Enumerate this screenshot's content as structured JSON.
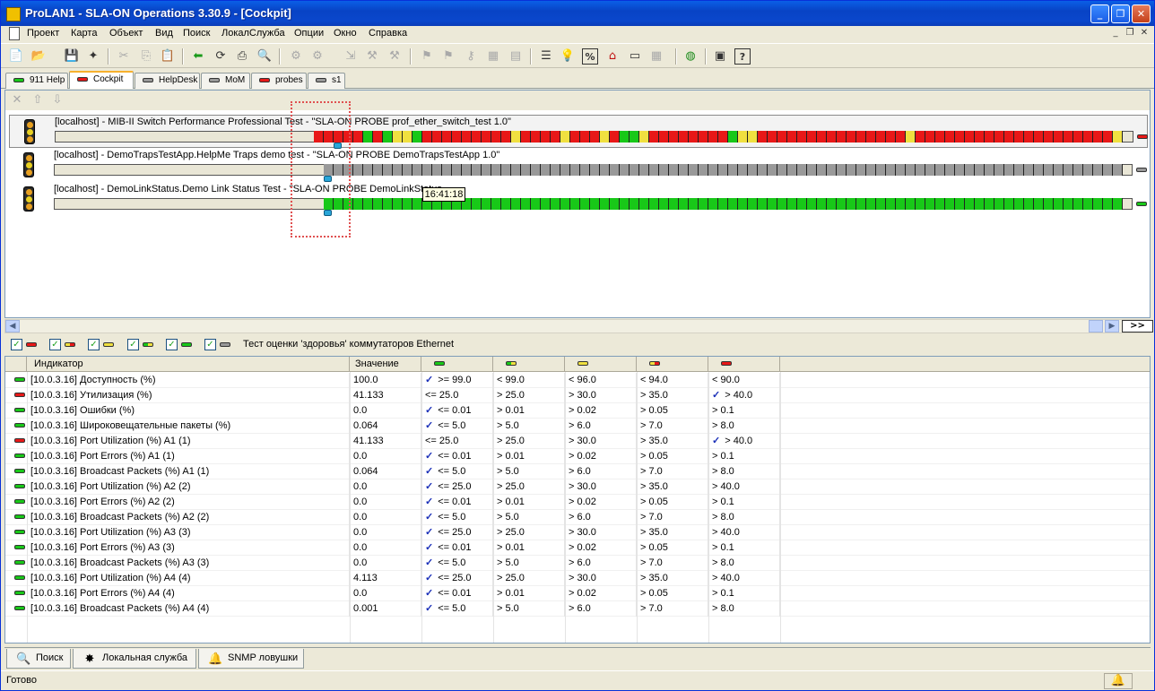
{
  "window": {
    "title": "ProLAN1 - SLA-ON Operations 3.30.9 - [Cockpit]"
  },
  "menu": [
    "Проект",
    "Карта",
    "Объект",
    "Вид",
    "Поиск",
    "ЛокалСлужба",
    "Опции",
    "Окно",
    "Справка"
  ],
  "toolbar_icons": [
    "new-icon",
    "open-icon",
    "save-icon",
    "wand-icon",
    "cut-icon",
    "copy-icon",
    "paste-icon",
    "back-icon",
    "refresh-icon",
    "browse-icon",
    "find-icon",
    "probe-icon",
    "map-icon",
    "discover-icon",
    "tool-icon",
    "tool-icon",
    "tool-icon",
    "tool-icon",
    "tool-icon",
    "tool-icon",
    "list-icon",
    "lightbulb-icon",
    "percent-icon",
    "home-icon",
    "monitor-icon",
    "table-icon",
    "globe-icon",
    "properties-icon",
    "help-icon"
  ],
  "tabs": [
    {
      "label": "911 Help",
      "color": "g"
    },
    {
      "label": "Cockpit",
      "color": "r",
      "active": true
    },
    {
      "label": "HelpDesk",
      "color": "gr"
    },
    {
      "label": "MoM",
      "color": "gr"
    },
    {
      "label": "probes",
      "color": "r"
    },
    {
      "label": "s1",
      "color": "gr"
    }
  ],
  "probes": [
    {
      "title": "[localhost] - MIB-II Switch Performance Professional Test - \"SLA-ON PROBE prof_ether_switch_test 1.0\"",
      "status": "r",
      "history": "rrrrrgrgyygrrrrrrrrryrrrryrrryrggyrrrrrrrrgyyrrrrrrrrrrrrrrryrrrrrrrrrrrrrrrrrrrryyyrrrrrrrrrrrrrryyryrrrr"
    },
    {
      "title": "[localhost] - DemoTrapsTestApp.HelpMe Traps demo test - \"SLA-ON PROBE DemoTrapsTestApp 1.0\"",
      "status": "gr"
    },
    {
      "title": "[localhost] - DemoLinkStatus.Demo Link Status Test - \"SLA-ON PROBE DemoLinkStatus",
      "status": "g"
    }
  ],
  "tooltip": "16:41:18",
  "filter_label": "Тест оценки 'здоровья' коммутаторов Ethernet",
  "grid": {
    "headers": [
      "Индикатор",
      "Значение"
    ],
    "threshold_colors": [
      "g",
      "gy",
      "y",
      "yr",
      "r"
    ],
    "rows": [
      {
        "status": "g",
        "name": "[10.0.3.16] Доступность (%)",
        "value": "100.0",
        "t": [
          ">= 99.0",
          "< 99.0",
          "< 96.0",
          "< 94.0",
          "< 90.0"
        ],
        "check": 0
      },
      {
        "status": "r",
        "name": "[10.0.3.16] Утилизация (%)",
        "value": "41.133",
        "t": [
          "<= 25.0",
          "> 25.0",
          "> 30.0",
          "> 35.0",
          "> 40.0"
        ],
        "check": 4
      },
      {
        "status": "g",
        "name": "[10.0.3.16] Ошибки (%)",
        "value": "0.0",
        "t": [
          "<= 0.01",
          "> 0.01",
          "> 0.02",
          "> 0.05",
          "> 0.1"
        ],
        "check": 0
      },
      {
        "status": "g",
        "name": "[10.0.3.16] Широковещательные пакеты (%)",
        "value": "0.064",
        "t": [
          "<= 5.0",
          "> 5.0",
          "> 6.0",
          "> 7.0",
          "> 8.0"
        ],
        "check": 0
      },
      {
        "status": "r",
        "name": "[10.0.3.16] Port Utilization (%) A1 (1)",
        "value": "41.133",
        "t": [
          "<= 25.0",
          "> 25.0",
          "> 30.0",
          "> 35.0",
          "> 40.0"
        ],
        "check": 4
      },
      {
        "status": "g",
        "name": "[10.0.3.16] Port Errors (%) A1 (1)",
        "value": "0.0",
        "t": [
          "<= 0.01",
          "> 0.01",
          "> 0.02",
          "> 0.05",
          "> 0.1"
        ],
        "check": 0
      },
      {
        "status": "g",
        "name": "[10.0.3.16] Broadcast Packets (%) A1 (1)",
        "value": "0.064",
        "t": [
          "<= 5.0",
          "> 5.0",
          "> 6.0",
          "> 7.0",
          "> 8.0"
        ],
        "check": 0
      },
      {
        "status": "g",
        "name": "[10.0.3.16] Port Utilization (%) A2 (2)",
        "value": "0.0",
        "t": [
          "<= 25.0",
          "> 25.0",
          "> 30.0",
          "> 35.0",
          "> 40.0"
        ],
        "check": 0
      },
      {
        "status": "g",
        "name": "[10.0.3.16] Port Errors (%) A2 (2)",
        "value": "0.0",
        "t": [
          "<= 0.01",
          "> 0.01",
          "> 0.02",
          "> 0.05",
          "> 0.1"
        ],
        "check": 0
      },
      {
        "status": "g",
        "name": "[10.0.3.16] Broadcast Packets (%) A2 (2)",
        "value": "0.0",
        "t": [
          "<= 5.0",
          "> 5.0",
          "> 6.0",
          "> 7.0",
          "> 8.0"
        ],
        "check": 0
      },
      {
        "status": "g",
        "name": "[10.0.3.16] Port Utilization (%) A3 (3)",
        "value": "0.0",
        "t": [
          "<= 25.0",
          "> 25.0",
          "> 30.0",
          "> 35.0",
          "> 40.0"
        ],
        "check": 0
      },
      {
        "status": "g",
        "name": "[10.0.3.16] Port Errors (%) A3 (3)",
        "value": "0.0",
        "t": [
          "<= 0.01",
          "> 0.01",
          "> 0.02",
          "> 0.05",
          "> 0.1"
        ],
        "check": 0
      },
      {
        "status": "g",
        "name": "[10.0.3.16] Broadcast Packets (%) A3 (3)",
        "value": "0.0",
        "t": [
          "<= 5.0",
          "> 5.0",
          "> 6.0",
          "> 7.0",
          "> 8.0"
        ],
        "check": 0
      },
      {
        "status": "g",
        "name": "[10.0.3.16] Port Utilization (%) A4 (4)",
        "value": "4.113",
        "t": [
          "<= 25.0",
          "> 25.0",
          "> 30.0",
          "> 35.0",
          "> 40.0"
        ],
        "check": 0
      },
      {
        "status": "g",
        "name": "[10.0.3.16] Port Errors (%) A4 (4)",
        "value": "0.0",
        "t": [
          "<= 0.01",
          "> 0.01",
          "> 0.02",
          "> 0.05",
          "> 0.1"
        ],
        "check": 0
      },
      {
        "status": "g",
        "name": "[10.0.3.16] Broadcast Packets (%) A4 (4)",
        "value": "0.001",
        "t": [
          "<= 5.0",
          "> 5.0",
          "> 6.0",
          "> 7.0",
          "> 8.0"
        ],
        "check": 0
      }
    ]
  },
  "bottom_tabs": [
    {
      "label": "Поиск",
      "icon": "search-icon"
    },
    {
      "label": "Локальная служба",
      "icon": "service-icon"
    },
    {
      "label": "SNMP ловушки",
      "icon": "bell-icon"
    }
  ],
  "status": {
    "text": "Готово"
  },
  "colors": {
    "green": "#18C818",
    "red": "#E81818",
    "yellow": "#F0E040",
    "gray": "#999999",
    "accent": "#0A47CC"
  }
}
